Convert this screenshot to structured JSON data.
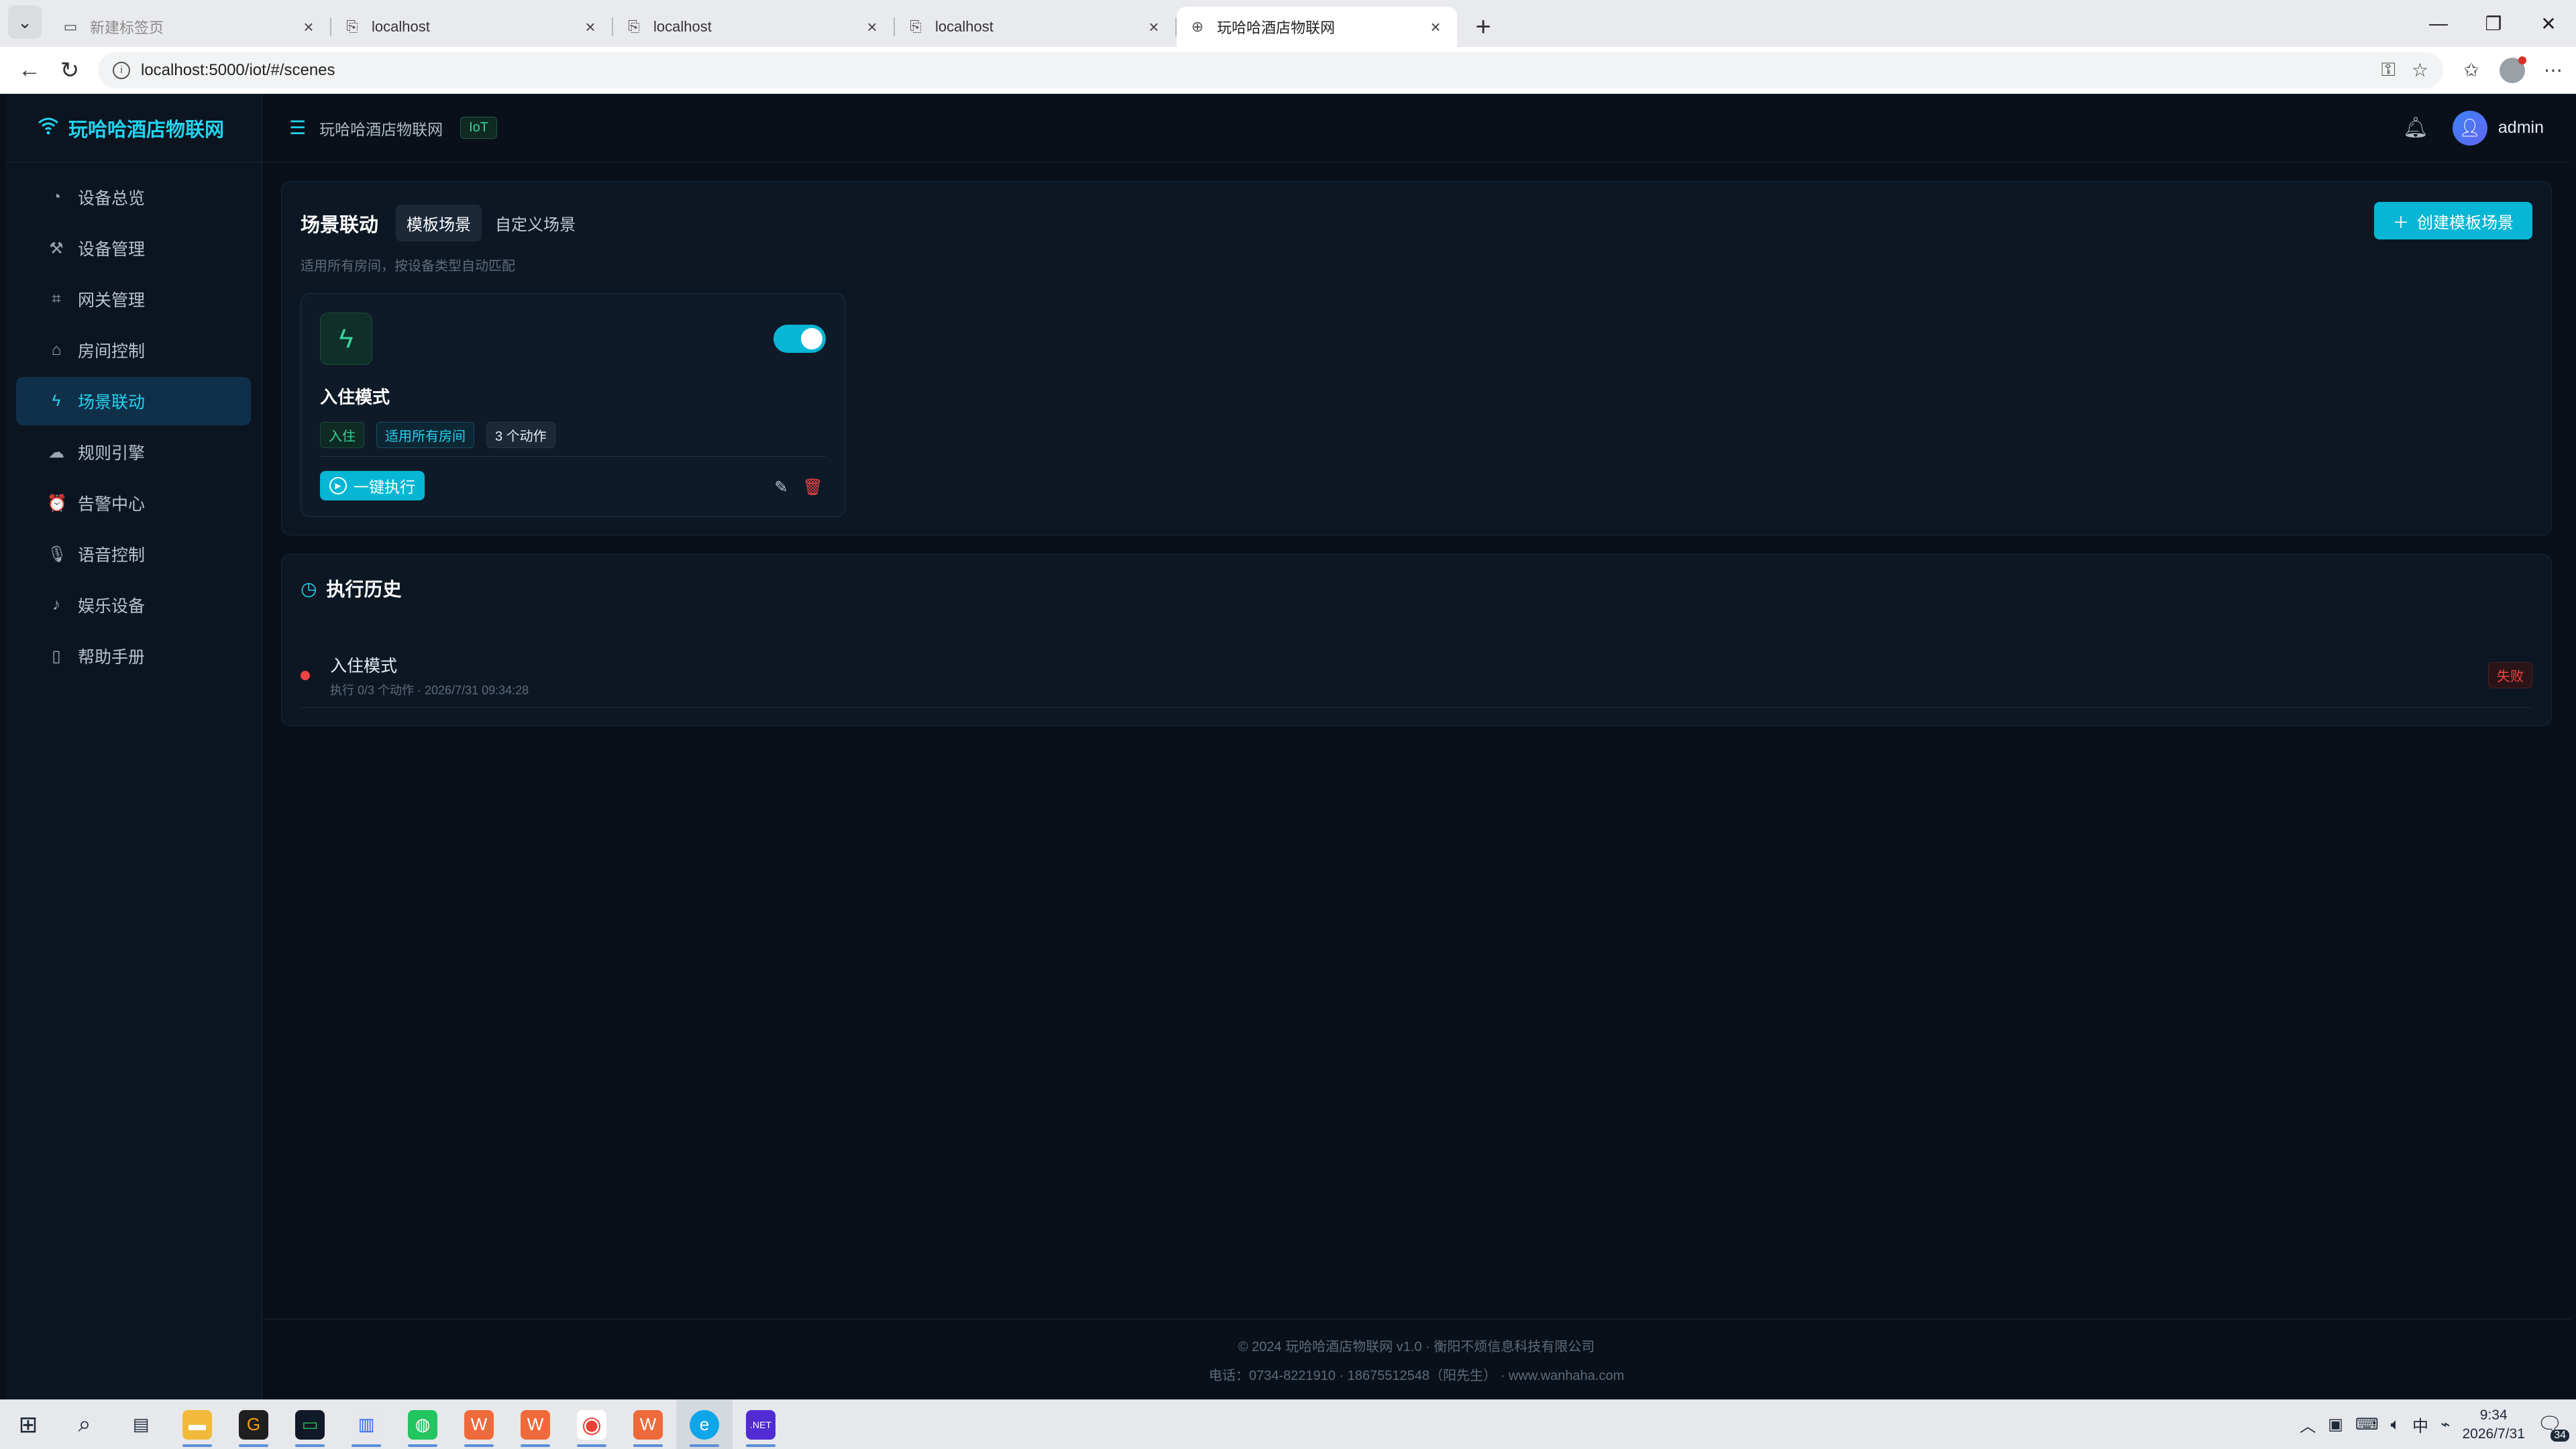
{
  "browser": {
    "tabs": [
      {
        "title": "新建标签页",
        "dim": true
      },
      {
        "title": "localhost"
      },
      {
        "title": "localhost"
      },
      {
        "title": "localhost"
      },
      {
        "title": "玩哈哈酒店物联网",
        "active": true
      }
    ],
    "url": "localhost:5000/iot/#/scenes"
  },
  "app": {
    "brand": "玩哈哈酒店物联网",
    "sidebar": {
      "items": [
        {
          "label": "设备总览",
          "icon": "dashboard-icon"
        },
        {
          "label": "设备管理",
          "icon": "wrench-icon"
        },
        {
          "label": "网关管理",
          "icon": "gateway-icon"
        },
        {
          "label": "房间控制",
          "icon": "home-icon"
        },
        {
          "label": "场景联动",
          "icon": "lightning-icon",
          "active": true
        },
        {
          "label": "规则引擎",
          "icon": "cloud-icon"
        },
        {
          "label": "告警中心",
          "icon": "alarm-icon"
        },
        {
          "label": "语音控制",
          "icon": "microphone-icon"
        },
        {
          "label": "娱乐设备",
          "icon": "gamepad-icon"
        },
        {
          "label": "帮助手册",
          "icon": "book-icon"
        }
      ]
    },
    "topbar": {
      "title": "玩哈哈酒店物联网",
      "badge": "IoT",
      "user": "admin"
    },
    "scenes": {
      "title": "场景联动",
      "tabs": [
        {
          "label": "模板场景",
          "active": true
        },
        {
          "label": "自定义场景"
        }
      ],
      "create_label": "创建模板场景",
      "subtitle": "适用所有房间，按设备类型自动匹配",
      "card": {
        "name": "入住模式",
        "enabled": true,
        "tags": [
          "入住",
          "适用所有房间",
          "3 个动作"
        ],
        "run_label": "一键执行"
      }
    },
    "history": {
      "title": "执行历史",
      "rows": [
        {
          "name": "入住模式",
          "meta": "执行 0/3 个动作 · 2026/7/31 09:34:28",
          "status": "失败"
        }
      ]
    },
    "footer": {
      "line1": "© 2024 玩哈哈酒店物联网 v1.0 · 衡阳不烦信息科技有限公司",
      "line2": "电话：0734-8221910 · 18675512548（阳先生） · www.wanhaha.com"
    }
  },
  "taskbar": {
    "time": "9:34",
    "date": "2026/7/31",
    "ime": "中",
    "notifications": "34"
  },
  "colors": {
    "accent": "#06b6d4",
    "accent_text": "#22d3ee",
    "success": "#34d399",
    "danger": "#ef4444",
    "background": "#0a1019"
  }
}
